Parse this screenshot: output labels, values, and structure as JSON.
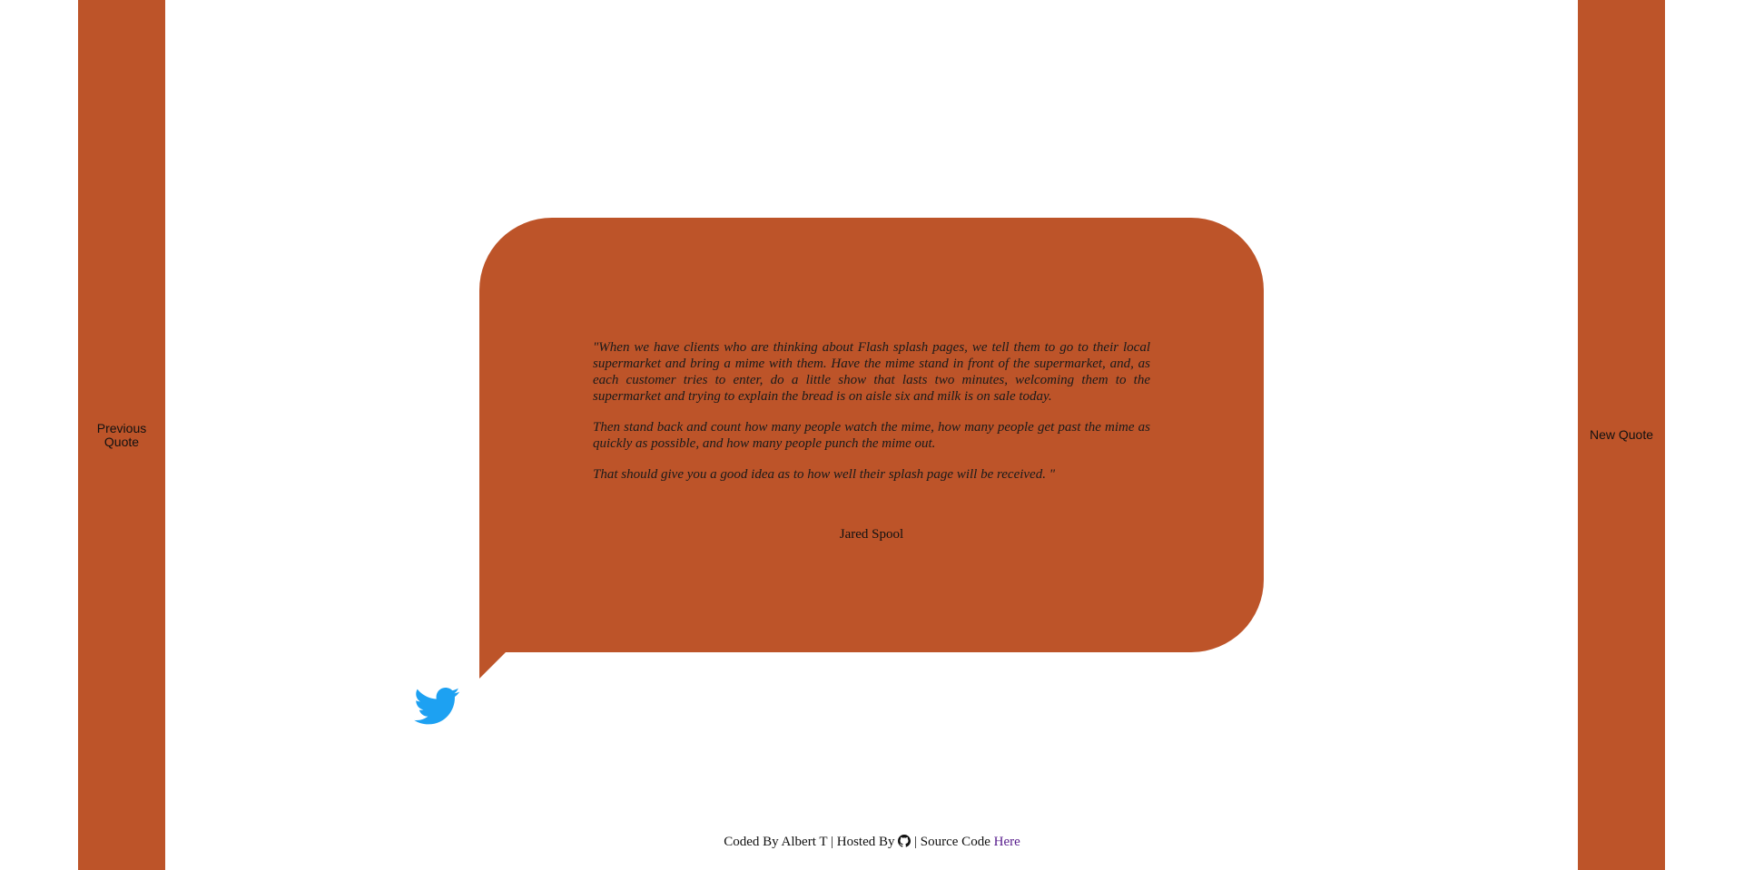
{
  "colors": {
    "accent": "#bd5429",
    "twitter": "#1da1f2",
    "link": "#551a8b"
  },
  "nav": {
    "previous_line1": "Previous",
    "previous_line2": "Quote",
    "new_quote": "New Quote"
  },
  "quote": {
    "paragraphs": [
      "\"When we have clients who are thinking about Flash splash pages, we tell them to go to their local supermarket and bring a mime with them. Have the mime stand in front of the supermarket, and, as each customer tries to enter, do a little show that lasts two minutes, welcoming them to the supermarket and trying to explain the bread is on aisle six and milk is on sale today.",
      "Then stand back and count how many people watch the mime, how many people get past the mime as quickly as possible, and how many people punch the mime out.",
      "That should give you a good idea as to how well their splash page will be received. \""
    ],
    "author": "Jared Spool"
  },
  "share": {
    "icon": "twitter-bird-icon"
  },
  "footer": {
    "coded_by": "Coded By Albert T",
    "separator": "|",
    "hosted_by": "Hosted By",
    "hosted_icon": "github-icon",
    "source_code": "Source Code",
    "link_text": "Here"
  }
}
